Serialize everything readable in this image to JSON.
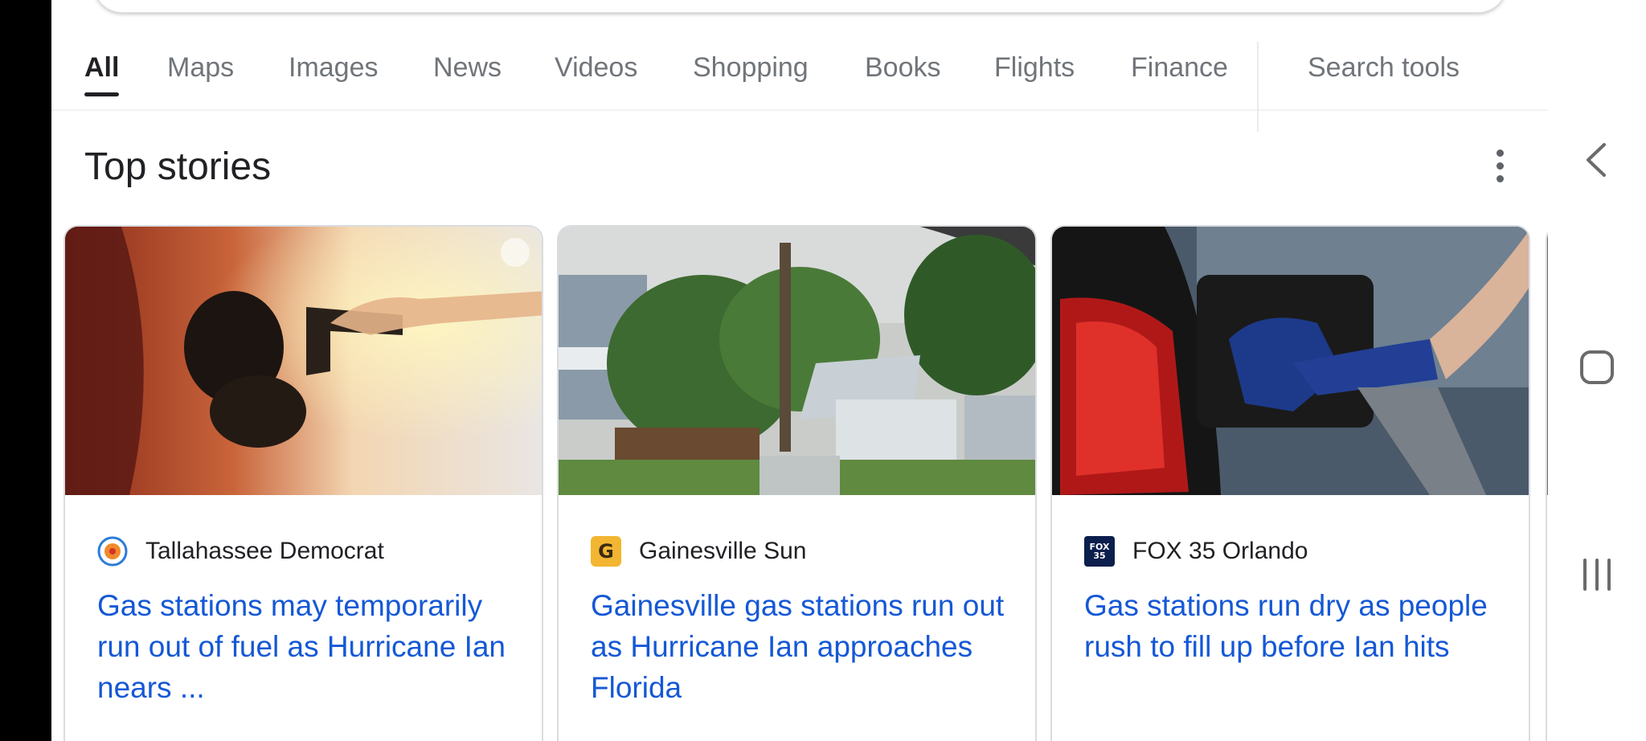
{
  "tabs": [
    {
      "label": "All",
      "active": true
    },
    {
      "label": "Maps"
    },
    {
      "label": "Images"
    },
    {
      "label": "News"
    },
    {
      "label": "Videos"
    },
    {
      "label": "Shopping"
    },
    {
      "label": "Books"
    },
    {
      "label": "Flights"
    },
    {
      "label": "Finance"
    },
    {
      "label": "Search tools"
    }
  ],
  "top_stories": {
    "title": "Top stories",
    "more_icon": "more-vert-icon",
    "cards": [
      {
        "source": "Tallahassee Democrat",
        "source_logo": "tallahassee-democrat-logo",
        "headline": "Gas stations may temporarily run out of fuel as Hurricane Ian nears ...",
        "image": "gas pump nozzle in car tank at sunset"
      },
      {
        "source": "Gainesville Sun",
        "source_logo": "gainesville-sun-logo",
        "logo_letter": "G",
        "headline": "Gainesville gas stations run out as Hurricane Ian approaches Florida",
        "image": "houses and trees under cloudy sky"
      },
      {
        "source": "FOX 35 Orlando",
        "source_logo": "fox35-logo",
        "logo_text": "FOX 35",
        "headline": "Gas stations run dry as people rush to fill up before Ian hits",
        "image": "hand holding blue fuel nozzle at red car"
      }
    ]
  },
  "system_nav": {
    "back": "back-icon",
    "home": "home-icon",
    "recents": "recents-icon"
  },
  "colors": {
    "link": "#1558d6",
    "text": "#202124",
    "muted": "#70757a",
    "border": "#dadce0"
  }
}
